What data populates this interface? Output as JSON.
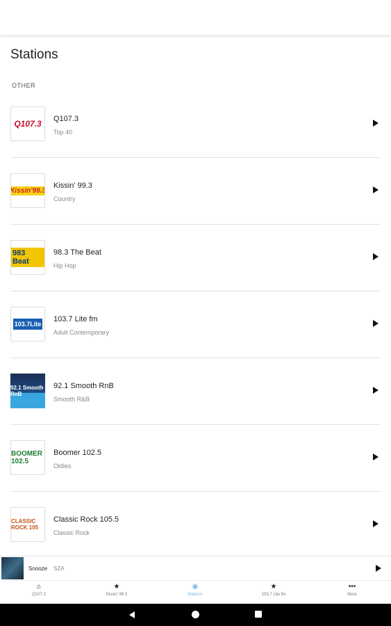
{
  "page": {
    "title": "Stations"
  },
  "section": {
    "label": "OTHER"
  },
  "stations": [
    {
      "name": "Q107.3",
      "genre": "Top 40",
      "logo_text": "Q107.3"
    },
    {
      "name": "Kissin' 99.3",
      "genre": "Country",
      "logo_text": "Kissin'99.3"
    },
    {
      "name": "98.3 The Beat",
      "genre": "Hip Hop",
      "logo_text": "983 Beat"
    },
    {
      "name": "103.7 Lite fm",
      "genre": "Adult Contemporary",
      "logo_text": "103.7Lite"
    },
    {
      "name": "92.1 Smooth RnB",
      "genre": "Smooth R&B",
      "logo_text": "92.1 Smooth RnB"
    },
    {
      "name": "Boomer 102.5",
      "genre": "Oldies",
      "logo_text": "BOOMER 102.5"
    },
    {
      "name": "Classic Rock 105.5",
      "genre": "Classic Rock",
      "logo_text": "CLASSIC ROCK 105"
    }
  ],
  "mini_player": {
    "title": "Snooze",
    "artist": "SZA"
  },
  "bottom_nav": [
    {
      "label": "Q107.3",
      "icon": "home-icon"
    },
    {
      "label": "Kissin' 99.3",
      "icon": "star-icon"
    },
    {
      "label": "Stations",
      "icon": "radio-icon",
      "active": true
    },
    {
      "label": "103.7 Lite fm",
      "icon": "star-icon"
    },
    {
      "label": "More",
      "icon": "more-icon"
    }
  ],
  "colors": {
    "active_tab": "#79b5e0",
    "divider": "#e2e2e2",
    "system_bar": "#000000"
  }
}
